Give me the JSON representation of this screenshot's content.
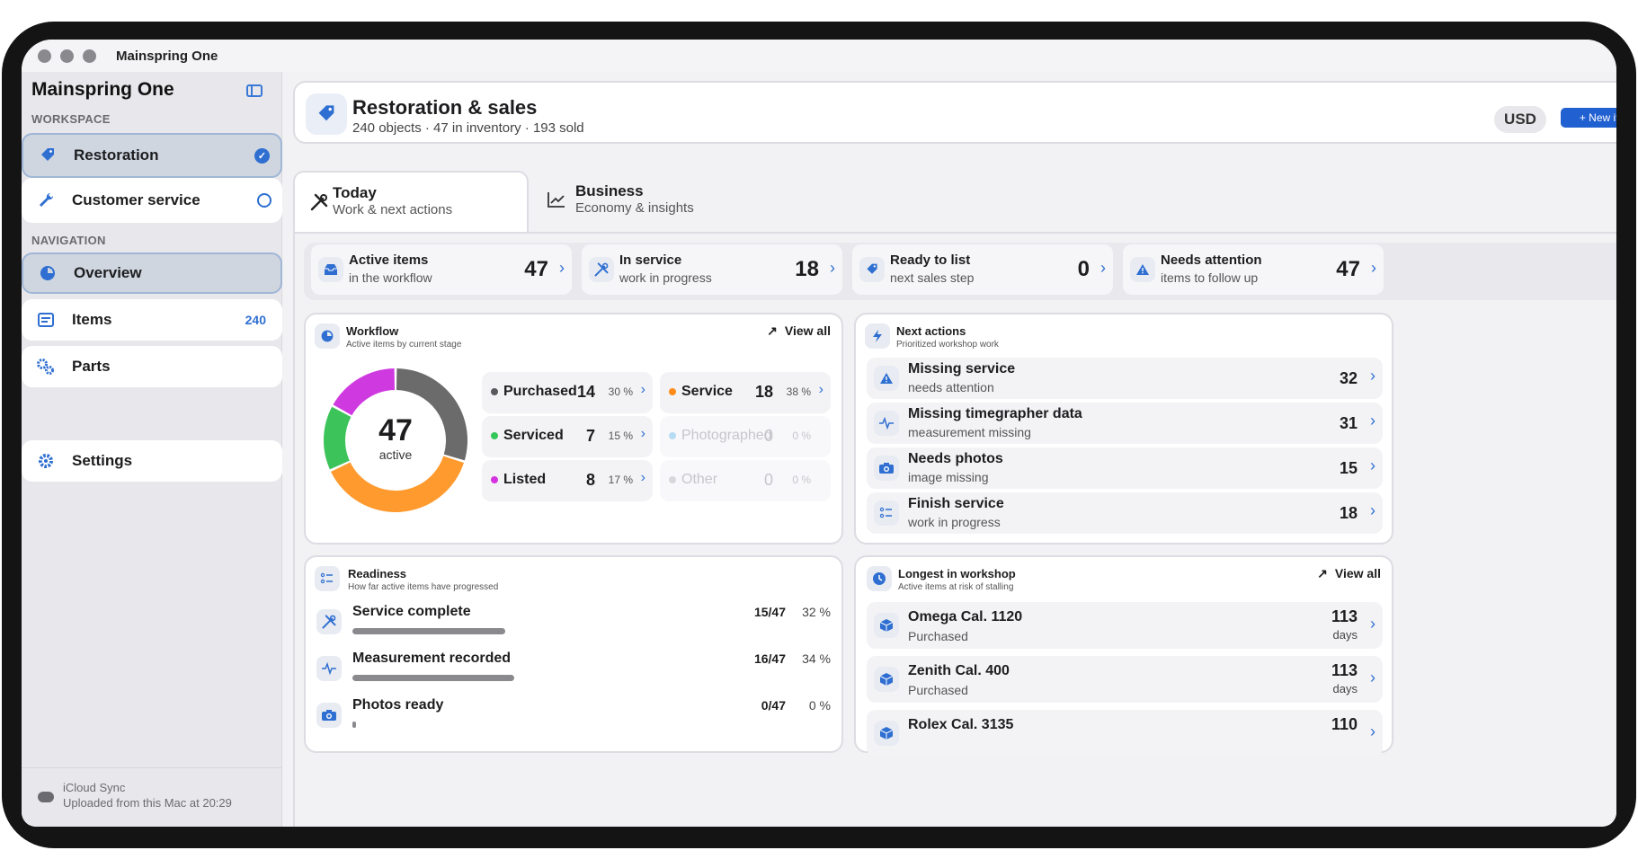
{
  "window": {
    "title": "Mainspring One"
  },
  "sidebar": {
    "app_name": "Mainspring One",
    "workspace_label": "WORKSPACE",
    "workspaces": [
      {
        "label": "Restoration",
        "selected": true
      },
      {
        "label": "Customer service",
        "selected": false
      }
    ],
    "navigation_label": "NAVIGATION",
    "nav": [
      {
        "label": "Overview",
        "selected": true
      },
      {
        "label": "Items",
        "count": "240"
      },
      {
        "label": "Parts"
      },
      {
        "label": "Settings"
      }
    ],
    "sync": {
      "title": "iCloud Sync",
      "status": "Uploaded from this Mac at 20:29"
    }
  },
  "header": {
    "title": "Restoration & sales",
    "subtitle": "240 objects · 47 in inventory · 193 sold",
    "currency": "USD",
    "new_item": "+ New item"
  },
  "tabs": [
    {
      "title": "Today",
      "subtitle": "Work & next actions",
      "icon": "tools-icon",
      "active": true
    },
    {
      "title": "Business",
      "subtitle": "Economy & insights",
      "icon": "chart-icon",
      "active": false
    }
  ],
  "stats": [
    {
      "title": "Active items",
      "subtitle": "in the workflow",
      "value": "47",
      "icon": "tray-icon"
    },
    {
      "title": "In service",
      "subtitle": "work in progress",
      "value": "18",
      "icon": "tools-icon"
    },
    {
      "title": "Ready to list",
      "subtitle": "next sales step",
      "value": "0",
      "icon": "tag-icon"
    },
    {
      "title": "Needs attention",
      "subtitle": "items to follow up",
      "value": "47",
      "icon": "warning-icon"
    }
  ],
  "workflow": {
    "title": "Workflow",
    "subtitle": "Active items by current stage",
    "view_all": "View all",
    "total": "47",
    "total_label": "active",
    "stages": [
      {
        "label": "Purchased",
        "count": "14",
        "pct": "30 %",
        "color": "#5a5a5e",
        "ring_color": "#6b6b6b",
        "value": 14,
        "active": true
      },
      {
        "label": "Service",
        "count": "18",
        "pct": "38 %",
        "color": "#ff8c1a",
        "ring_color": "#ff9a2e",
        "value": 18,
        "active": true
      },
      {
        "label": "Serviced",
        "count": "7",
        "pct": "15 %",
        "color": "#34c759",
        "ring_color": "#3cc35a",
        "value": 7,
        "active": true
      },
      {
        "label": "Photographed",
        "count": "0",
        "pct": "0 %",
        "color": "#b6dcf4",
        "ring_color": "#b6dcf4",
        "value": 0,
        "active": false
      },
      {
        "label": "Listed",
        "count": "8",
        "pct": "17 %",
        "color": "#d633e0",
        "ring_color": "#cf3ae0",
        "value": 8,
        "active": true
      },
      {
        "label": "Other",
        "count": "0",
        "pct": "0 %",
        "color": "#d8d8dc",
        "ring_color": "#d8d8dc",
        "value": 0,
        "active": false
      }
    ]
  },
  "next_actions": {
    "title": "Next actions",
    "subtitle": "Prioritized workshop work",
    "items": [
      {
        "title": "Missing service",
        "subtitle": "needs attention",
        "count": "32",
        "icon": "warning-icon"
      },
      {
        "title": "Missing timegrapher data",
        "subtitle": "measurement missing",
        "count": "31",
        "icon": "waveform-icon"
      },
      {
        "title": "Needs photos",
        "subtitle": "image missing",
        "count": "15",
        "icon": "camera-icon"
      },
      {
        "title": "Finish service",
        "subtitle": "work in progress",
        "count": "18",
        "icon": "checklist-icon"
      }
    ]
  },
  "readiness": {
    "title": "Readiness",
    "subtitle": "How far active items have progressed",
    "items": [
      {
        "title": "Service complete",
        "ratio": "15/47",
        "pct": "32 %",
        "progress": 0.32,
        "icon": "tools-icon"
      },
      {
        "title": "Measurement recorded",
        "ratio": "16/47",
        "pct": "34 %",
        "progress": 0.34,
        "icon": "waveform-icon"
      },
      {
        "title": "Photos ready",
        "ratio": "0/47",
        "pct": "0 %",
        "progress": 0.0,
        "icon": "camera-icon"
      }
    ]
  },
  "longest": {
    "title": "Longest in workshop",
    "subtitle": "Active items at risk of stalling",
    "view_all": "View all",
    "items": [
      {
        "title": "Omega Cal. 1120",
        "subtitle": "Purchased",
        "days": "113",
        "unit": "days"
      },
      {
        "title": "Zenith Cal. 400",
        "subtitle": "Purchased",
        "days": "113",
        "unit": "days"
      },
      {
        "title": "Rolex Cal. 3135",
        "subtitle": "",
        "days": "110",
        "unit": ""
      }
    ]
  }
}
